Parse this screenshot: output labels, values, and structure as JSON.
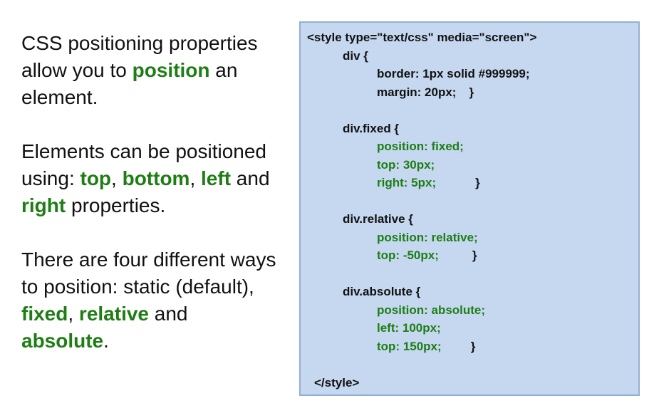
{
  "text_col": {
    "p1": {
      "a": "CSS positioning properties allow you to ",
      "b": "position",
      "c": " an element."
    },
    "p2": {
      "a": "Elements can be positioned using: ",
      "b": "top",
      "c": ", ",
      "d": "bottom",
      "e": ", ",
      "f": "left",
      "g": " and ",
      "h": "right",
      "i": " properties."
    },
    "p3": {
      "a": "There are four different ways to position: static (default), ",
      "b": "fixed",
      "c": ", ",
      "d": "relative",
      "e": " and ",
      "f": "absolute",
      "g": "."
    }
  },
  "code": {
    "open_tag": "<style type=\"text/css\" media=\"screen\">",
    "div_sel": "div {",
    "div_p1": "border: 1px solid #999999;",
    "div_p2": "margin: 20px;",
    "close": "}",
    "fixed_sel": "div.fixed {",
    "fixed_p1": "position: fixed;",
    "fixed_p2": "top: 30px;",
    "fixed_p3": "right: 5px;",
    "rel_sel": "div.relative {",
    "rel_p1": "position: relative;",
    "rel_p2": "top: -50px;",
    "abs_sel": "div.absolute {",
    "abs_p1": "position: absolute;",
    "abs_p2": "left: 100px;",
    "abs_p3": "top: 150px;",
    "close_tag": "</style>"
  },
  "colors": {
    "highlight_green": "#1e7d14",
    "code_box_bg": "#c5d8f0",
    "code_box_border": "#93b0d3"
  }
}
